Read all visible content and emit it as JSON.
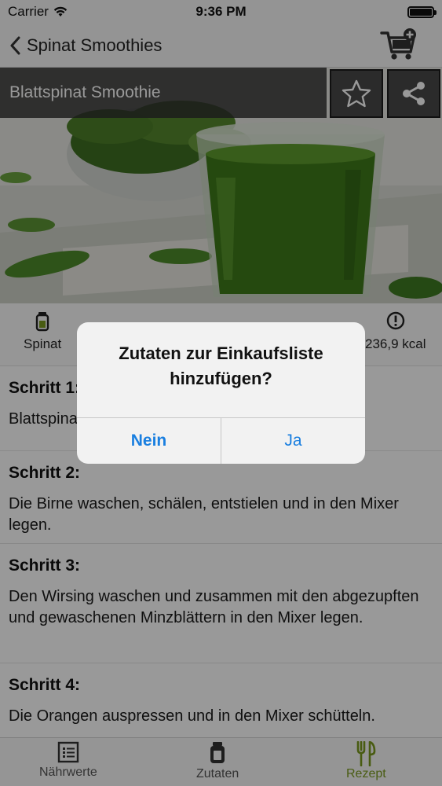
{
  "status_bar": {
    "carrier": "Carrier",
    "time": "9:36 PM"
  },
  "nav": {
    "back_label": "Spinat Smoothies"
  },
  "recipe": {
    "title": "Blattspinat Smoothie"
  },
  "info": [
    {
      "label": "Spinat",
      "icon": "jar-icon"
    },
    {
      "label": "236,9 kcal",
      "icon": "info-icon"
    }
  ],
  "steps": [
    {
      "title": "Schritt 1:",
      "text": "Blattspinat"
    },
    {
      "title": "Schritt 2:",
      "text": "Die Birne waschen, schälen, entstielen und in den Mixer legen."
    },
    {
      "title": "Schritt 3:",
      "text": "Den Wirsing waschen und zusammen mit den abgezupften und gewaschenen Minzblättern in den Mixer legen."
    },
    {
      "title": "Schritt 4:",
      "text": "Die Orangen auspressen und in den Mixer schütteln."
    }
  ],
  "tabs": [
    {
      "label": "Nährwerte",
      "icon": "list-icon"
    },
    {
      "label": "Zutaten",
      "icon": "jar-icon"
    },
    {
      "label": "Rezept",
      "icon": "fork-knife-icon"
    }
  ],
  "alert": {
    "title": "Zutaten zur Einkaufsliste hinzufügen?",
    "cancel": "Nein",
    "confirm": "Ja"
  },
  "colors": {
    "accent": "#7b9a1f",
    "link": "#1a7fe0",
    "smoothie_green": "#3e7a1a"
  }
}
